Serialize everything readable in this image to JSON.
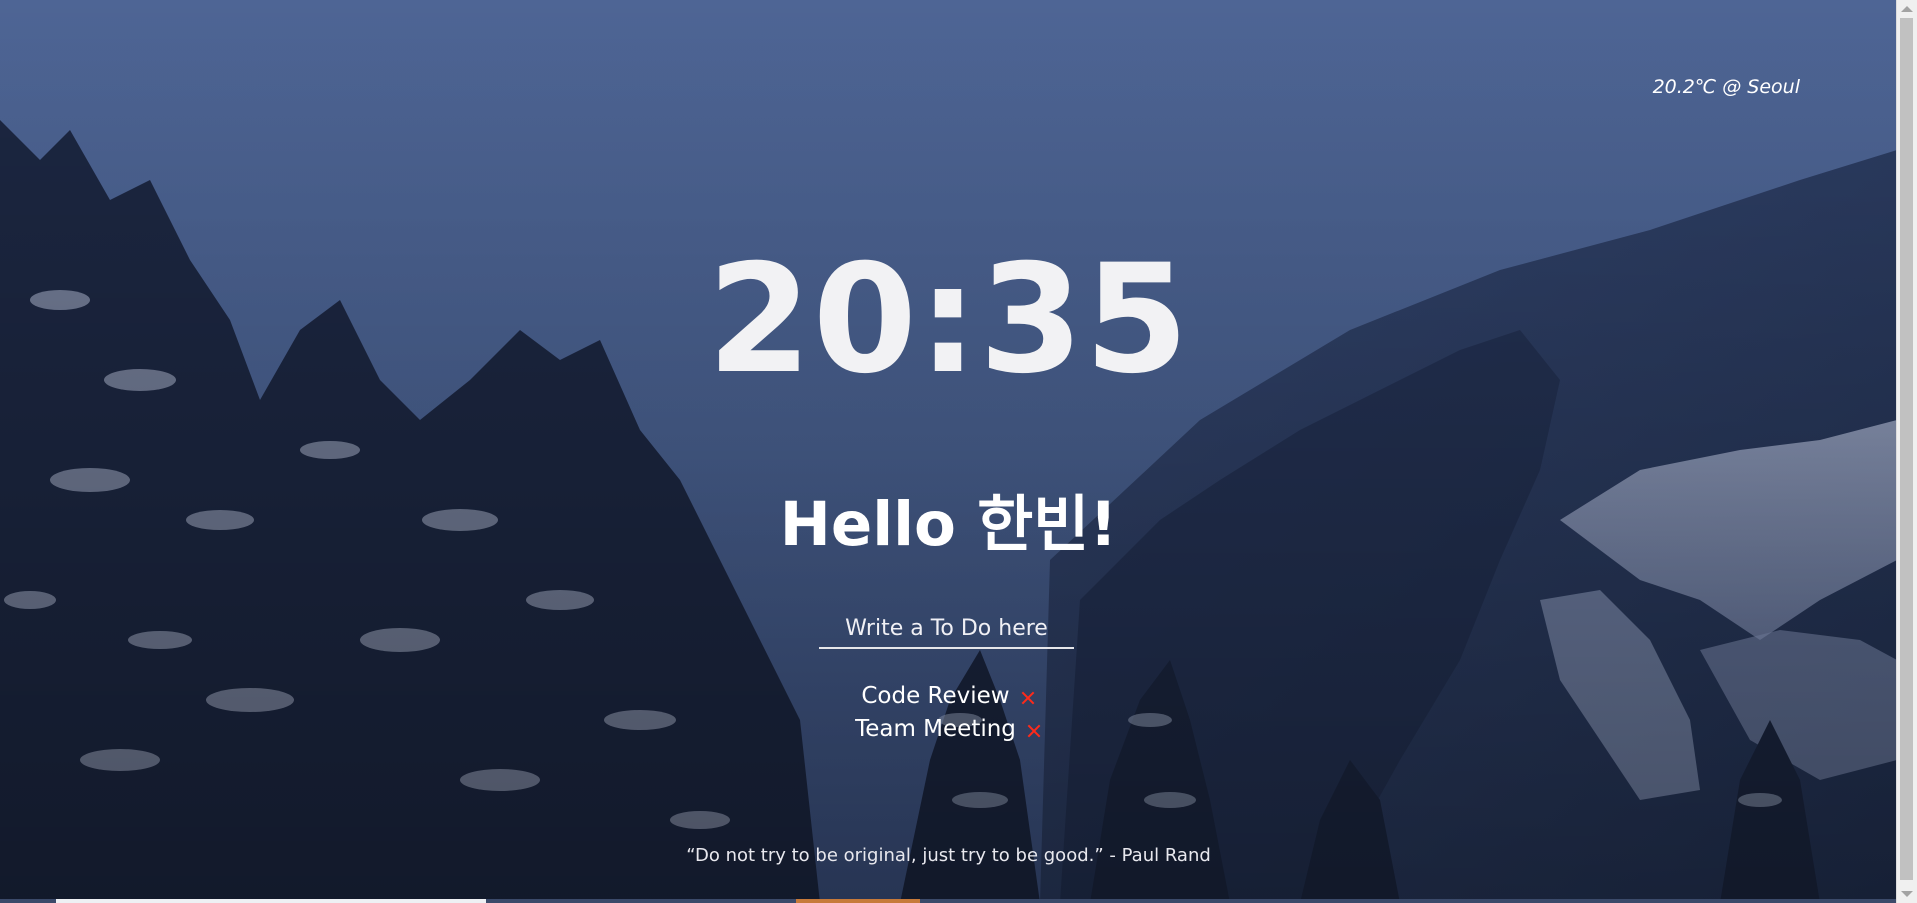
{
  "weather": {
    "text": "20.2℃ @ Seoul"
  },
  "clock": {
    "time": "20:35"
  },
  "greeting": {
    "text": "Hello 한빈!"
  },
  "todo": {
    "placeholder": "Write a To Do here",
    "value": "",
    "items": [
      {
        "label": "Code Review",
        "delete_icon": "close-icon"
      },
      {
        "label": "Team Meeting",
        "delete_icon": "close-icon"
      }
    ]
  },
  "quote": {
    "text": "“Do not try to be original, just try to be good.” - Paul Rand"
  },
  "colors": {
    "sky": "#4d6494",
    "text": "#ffffff",
    "delete_accent": "#ff2a1a"
  }
}
